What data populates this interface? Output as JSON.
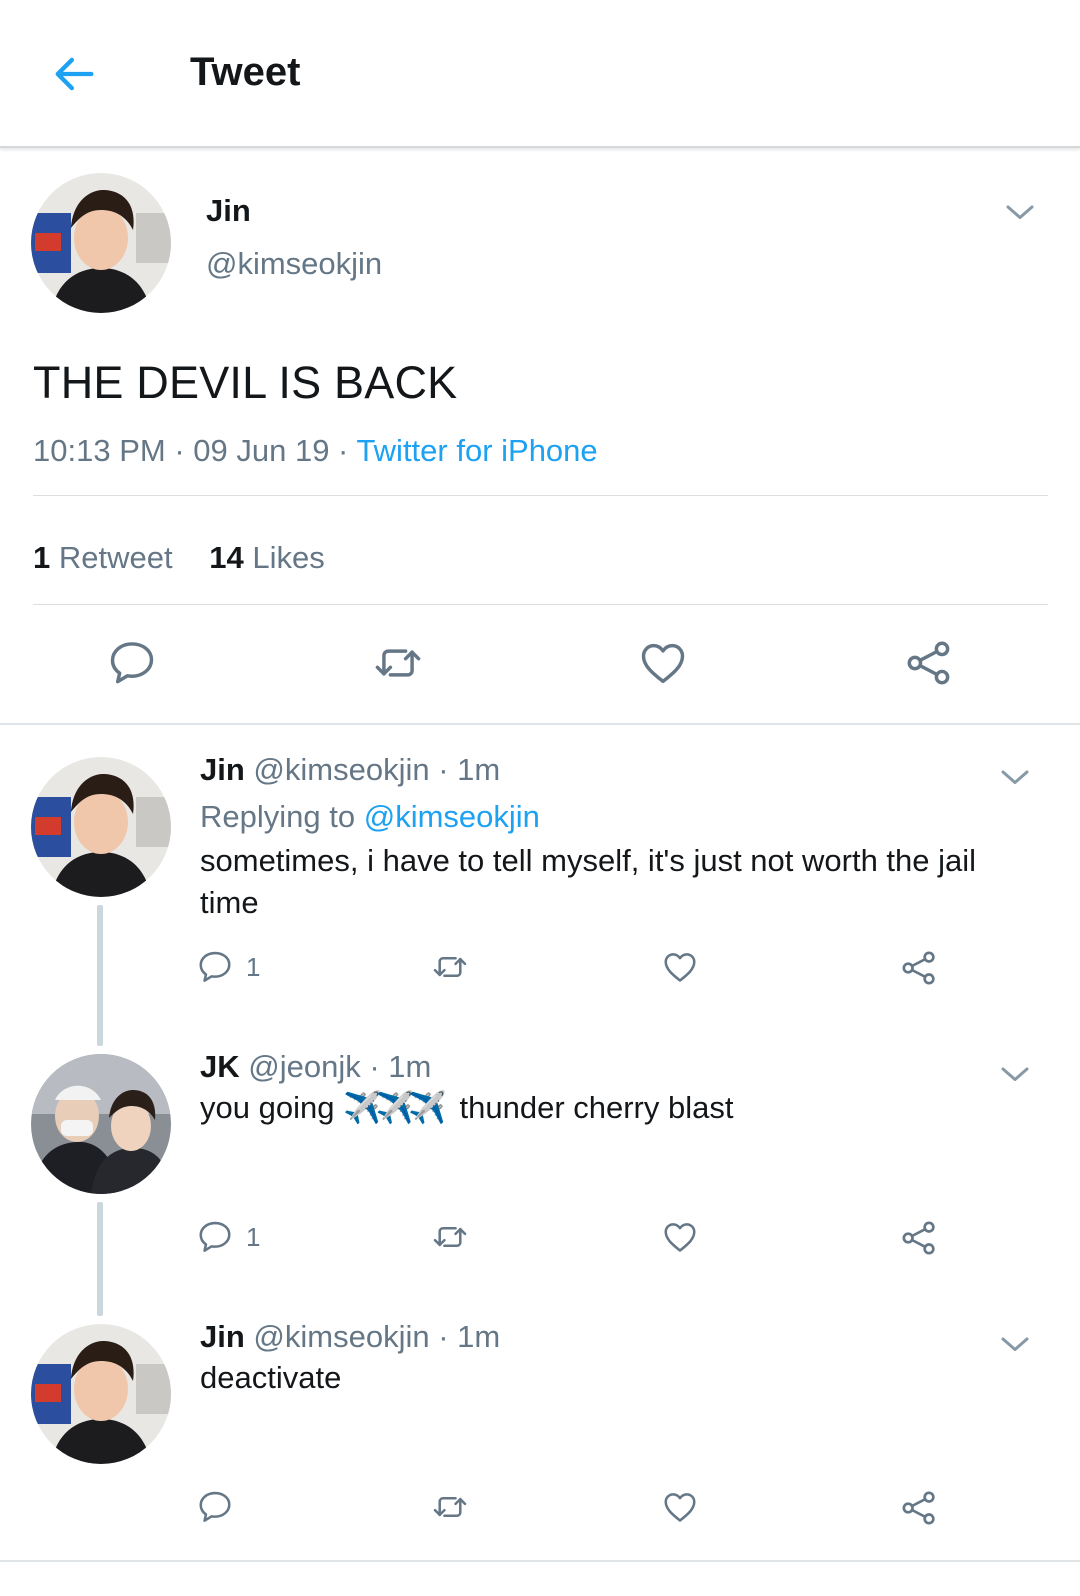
{
  "topbar": {
    "title": "Tweet",
    "back_icon": "arrow-left-icon"
  },
  "colors": {
    "accent": "#1da1f2",
    "muted": "#657786",
    "text": "#14171a",
    "divider": "#dcdfe1",
    "thread": "#ccd6dd"
  },
  "tweet": {
    "name": "Jin",
    "handle": "@kimseokjin",
    "text": "THE DEVIL IS BACK",
    "time": "10:13 PM",
    "date": "09 Jun 19",
    "source": "Twitter for iPhone",
    "retweets": {
      "count": "1",
      "label": "Retweet"
    },
    "likes": {
      "count": "14",
      "label": "Likes"
    }
  },
  "replies": [
    {
      "name": "Jin",
      "handle": "@kimseokjin",
      "age": "1m",
      "replying_label": "Replying to",
      "replying_to": "@kimseokjin",
      "text": "sometimes, i have to tell myself, it's just not worth the jail time",
      "reply_count": "1"
    },
    {
      "name": "JK",
      "handle": "@jeonjk",
      "age": "1m",
      "text_before": "you going",
      "emoji": "✈️✈️✈️",
      "text_after": "thunder cherry blast",
      "reply_count": "1"
    },
    {
      "name": "Jin",
      "handle": "@kimseokjin",
      "age": "1m",
      "text": "deactivate",
      "reply_count": ""
    }
  ],
  "icons": {
    "reply": "reply-bubble-icon",
    "retweet": "retweet-icon",
    "like": "heart-icon",
    "share": "share-icon",
    "menu": "chevron-down-icon"
  }
}
